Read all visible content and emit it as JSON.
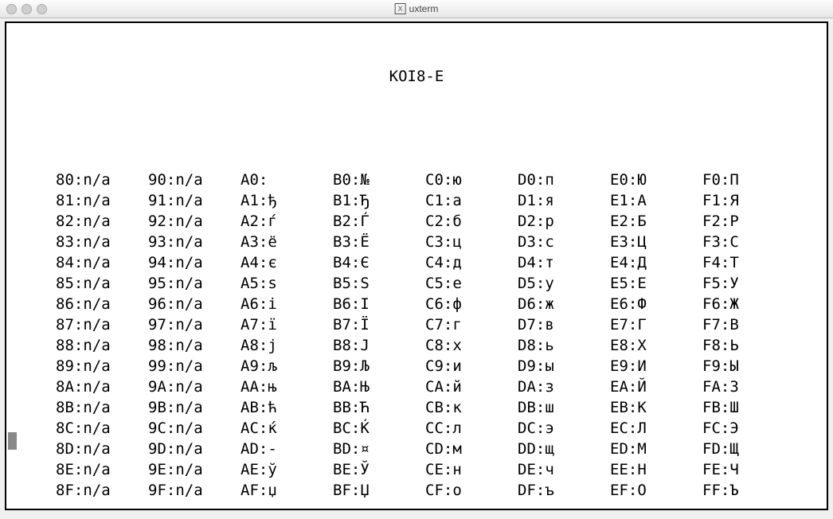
{
  "window": {
    "app_icon_label": "X",
    "title": "uxterm"
  },
  "heading": "KOI8-E",
  "codepoints": {
    "80": "n/a",
    "81": "n/a",
    "82": "n/a",
    "83": "n/a",
    "84": "n/a",
    "85": "n/a",
    "86": "n/a",
    "87": "n/a",
    "88": "n/a",
    "89": "n/a",
    "8A": "n/a",
    "8B": "n/a",
    "8C": "n/a",
    "8D": "n/a",
    "8E": "n/a",
    "8F": "n/a",
    "90": "n/a",
    "91": "n/a",
    "92": "n/a",
    "93": "n/a",
    "94": "n/a",
    "95": "n/a",
    "96": "n/a",
    "97": "n/a",
    "98": "n/a",
    "99": "n/a",
    "9A": "n/a",
    "9B": "n/a",
    "9C": "n/a",
    "9D": "n/a",
    "9E": "n/a",
    "9F": "n/a",
    "A0": " ",
    "A1": "ђ",
    "A2": "ѓ",
    "A3": "ё",
    "A4": "є",
    "A5": "ѕ",
    "A6": "і",
    "A7": "ї",
    "A8": "ј",
    "A9": "љ",
    "AA": "њ",
    "AB": "ћ",
    "AC": "ќ",
    "AD": "­-",
    "AE": "ў",
    "AF": "џ",
    "B0": "№",
    "B1": "Ђ",
    "B2": "Ѓ",
    "B3": "Ё",
    "B4": "Є",
    "B5": "Ѕ",
    "B6": "І",
    "B7": "Ї",
    "B8": "Ј",
    "B9": "Љ",
    "BA": "Њ",
    "BB": "Ћ",
    "BC": "Ќ",
    "BD": "¤",
    "BE": "Ў",
    "BF": "Џ",
    "C0": "ю",
    "C1": "а",
    "C2": "б",
    "C3": "ц",
    "C4": "д",
    "C5": "е",
    "C6": "ф",
    "C7": "г",
    "C8": "х",
    "C9": "и",
    "CA": "й",
    "CB": "к",
    "CC": "л",
    "CD": "м",
    "CE": "н",
    "CF": "о",
    "D0": "п",
    "D1": "я",
    "D2": "р",
    "D3": "с",
    "D4": "т",
    "D5": "у",
    "D6": "ж",
    "D7": "в",
    "D8": "ь",
    "D9": "ы",
    "DA": "з",
    "DB": "ш",
    "DC": "э",
    "DD": "щ",
    "DE": "ч",
    "DF": "ъ",
    "E0": "Ю",
    "E1": "А",
    "E2": "Б",
    "E3": "Ц",
    "E4": "Д",
    "E5": "Е",
    "E6": "Ф",
    "E7": "Г",
    "E8": "Х",
    "E9": "И",
    "EA": "Й",
    "EB": "К",
    "EC": "Л",
    "ED": "М",
    "EE": "Н",
    "EF": "О",
    "F0": "П",
    "F1": "Я",
    "F2": "Р",
    "F3": "С",
    "F4": "Т",
    "F5": "У",
    "F6": "Ж",
    "F7": "В",
    "F8": "Ь",
    "F9": "Ы",
    "FA": "З",
    "FB": "Ш",
    "FC": "Э",
    "FD": "Щ",
    "FE": "Ч",
    "FF": "Ъ"
  },
  "column_order": [
    "8",
    "9",
    "A",
    "B",
    "C",
    "D",
    "E",
    "F"
  ],
  "row_order": [
    "0",
    "1",
    "2",
    "3",
    "4",
    "5",
    "6",
    "7",
    "8",
    "9",
    "A",
    "B",
    "C",
    "D",
    "E",
    "F"
  ]
}
